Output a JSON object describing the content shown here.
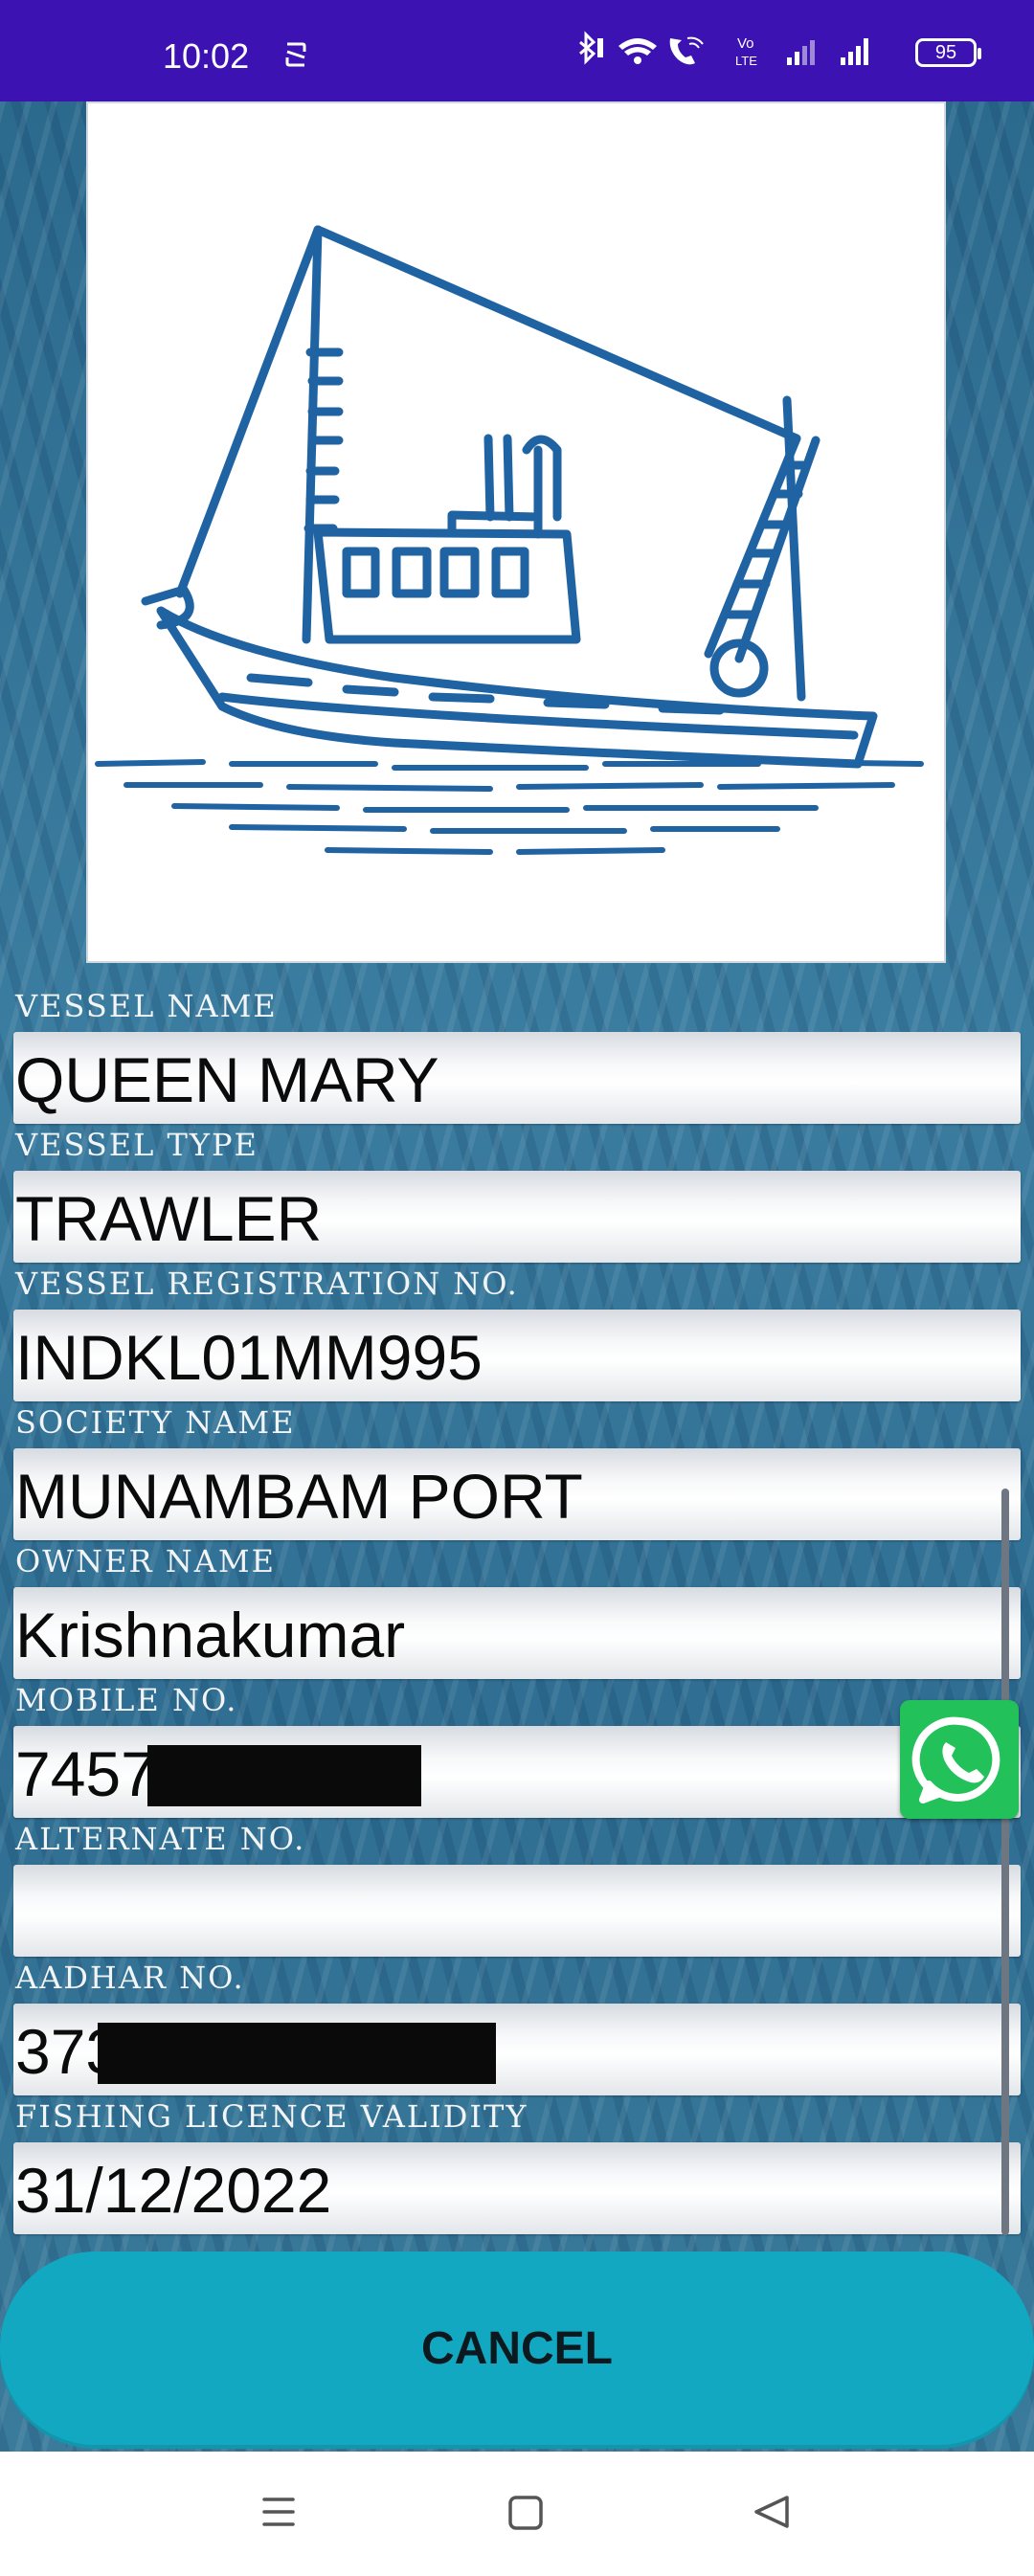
{
  "status_bar": {
    "time": "10:02",
    "battery": "95",
    "icons": [
      "sync-icon",
      "bluetooth-icon",
      "wifi-icon",
      "wifi-calling-icon",
      "volte-icon",
      "signal-1-icon",
      "signal-2-icon",
      "battery-icon"
    ]
  },
  "image": {
    "alt": "fishing-boat-sketch"
  },
  "fields": [
    {
      "label": "VESSEL NAME",
      "value": "QUEEN MARY"
    },
    {
      "label": "VESSEL TYPE",
      "value": "TRAWLER"
    },
    {
      "label": "VESSEL REGISTRATION NO.",
      "value": "INDKL01MM995"
    },
    {
      "label": "SOCIETY NAME",
      "value": "MUNAMBAM PORT"
    },
    {
      "label": "OWNER NAME",
      "value": "Krishnakumar"
    },
    {
      "label": "MOBILE NO.",
      "value": "7457587875"
    },
    {
      "label": "ALTERNATE NO.",
      "value": ""
    },
    {
      "label": "AADHAR NO.",
      "value": "373375878787"
    },
    {
      "label": "FISHING LICENCE VALIDITY",
      "value": "31/12/2022"
    }
  ],
  "actions": {
    "cancel": "CANCEL"
  },
  "floating": {
    "icon": "whatsapp-icon"
  },
  "nav": {
    "icons": [
      "menu-icon",
      "home-icon",
      "back-icon"
    ]
  },
  "colors": {
    "status_bar": "#3d12b2",
    "button": "#13a8c1",
    "boat_ink": "#1f63a3",
    "whatsapp": "#23c15a"
  }
}
